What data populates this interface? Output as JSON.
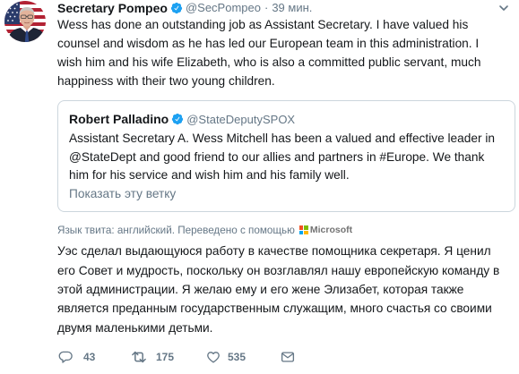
{
  "tweet": {
    "author": {
      "name": "Secretary Pompeo",
      "handle": "@SecPompeo",
      "verified": true
    },
    "separator": "·",
    "time": "39 мин.",
    "menu_icon": "chevron-down-icon",
    "text": "Wess has done an outstanding job as Assistant Secretary. I have valued his counsel and wisdom as he has led our European team in this administration. I wish him and his wife Elizabeth, who is also a committed public servant, much happiness with their two young children.",
    "quoted_tweet": {
      "author": {
        "name": "Robert Palladino",
        "handle": "@StateDeputySPOX",
        "verified": true
      },
      "text": "Assistant Secretary A. Wess Mitchell has been a valued and effective leader in @StateDept and good friend to our allies and partners in #Europe. We thank him for his service and wish him and his family well.",
      "show_thread_label": "Показать эту ветку"
    },
    "translation": {
      "label": "Язык твита: английский. Переведено с помощью",
      "provider": "Microsoft",
      "text": "Уэс сделал выдающуюся работу в качестве помощника секретаря. Я ценил его Совет и мудрость, поскольку он возглавлял нашу европейскую команду в этой администрации. Я желаю ему и его жене Элизабет, которая также является преданным государственным служащим, много счастья со своими двумя маленькими детьми."
    },
    "actions": [
      {
        "icon": "reply-icon",
        "count": 43
      },
      {
        "icon": "retweet-icon",
        "count": 175
      },
      {
        "icon": "heart-icon",
        "count": 535
      },
      {
        "icon": "envelope-icon"
      }
    ]
  },
  "colors": {
    "text": "#14171a",
    "muted": "#657786",
    "accent": "#1da1f2",
    "border": "#ccd6dd",
    "ms_red": "#f25022",
    "ms_green": "#7fba00",
    "ms_blue": "#00a4ef",
    "ms_yellow": "#ffb900",
    "ms_wordmark": "#737373"
  }
}
